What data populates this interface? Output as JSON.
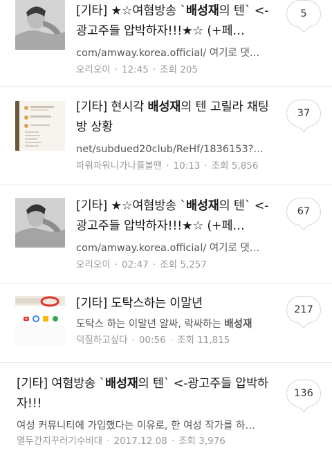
{
  "posts": [
    {
      "title_prefix": "[기타] ★☆여혐방송 `",
      "title_bold": "배성재",
      "title_suffix": "의 텐` <-광고주들 압박하자!!!★☆ (+페…",
      "snippet": "com/amway.korea.official/ 여기로 댓…",
      "author": "오리오이",
      "time": "12:45",
      "views": "조회 205",
      "comments": "5"
    },
    {
      "title_prefix": "[기타] 현시각 ",
      "title_bold": "배성재",
      "title_suffix": "의 텐 고릴라 채팅방 상황",
      "snippet": "net/subdued20club/ReHf/1836153?…",
      "author": "파워파워니가나를볼땐",
      "time": "10:13",
      "views": "조회 5,856",
      "comments": "37"
    },
    {
      "title_prefix": "[기타] ★☆여혐방송 `",
      "title_bold": "배성재",
      "title_suffix": "의 텐` <-광고주들 압박하자!!!★☆ (+페…",
      "snippet": "com/amway.korea.official/ 여기로 댓…",
      "author": "오리오이",
      "time": "02:47",
      "views": "조회 5,257",
      "comments": "67"
    },
    {
      "title_prefix": "[기타] 도탁스하는 이말년",
      "title_bold": "",
      "title_suffix": "",
      "snippet_prefix": "도탁스 하는 이말년 알싸, 락싸하는 ",
      "snippet_bold": "배성재",
      "author": "덕질하고싶다",
      "time": "00:56",
      "views": "조회 11,815",
      "comments": "217"
    },
    {
      "title_prefix": "[기타] 여혐방송 `",
      "title_bold": "배성재",
      "title_suffix": "의 텐` <-광고주들 압박하자!!!",
      "snippet": "여성 커뮤니티에 가입했다는 이유로, 한 여성 작가를 하…",
      "author": "열두간지꾸러기수비대",
      "time": "2017.12.08",
      "views": "조회 3,976",
      "comments": "136"
    }
  ],
  "colors": {
    "text": "#1a1a1a",
    "meta": "#9a9a9a",
    "divider": "#e6e6e6",
    "bubble_border": "#d6d6d6"
  }
}
